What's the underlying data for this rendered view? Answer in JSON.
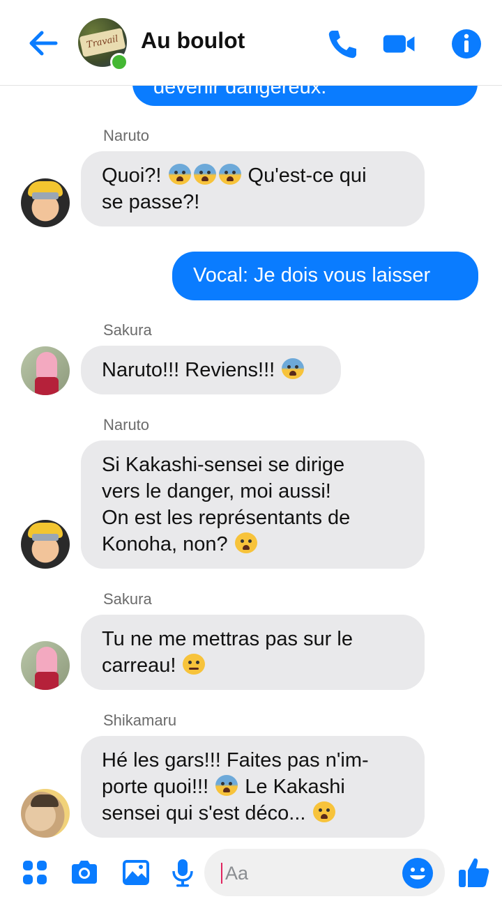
{
  "header": {
    "title": "Au boulot",
    "avatar_text": "Travail",
    "back_icon": "back-arrow-icon",
    "actions": [
      "phone-icon",
      "video-camera-icon",
      "info-icon"
    ]
  },
  "messages": {
    "top_partial": "devenir dangereux.",
    "m1": {
      "sender": "Naruto",
      "line1": "Quoi?! ",
      "line1b": " Qu'est-ce qui",
      "line2": "se passe?!"
    },
    "m2": {
      "text": "Vocal: Je dois vous laisser"
    },
    "m3": {
      "sender": "Sakura",
      "text": "Naruto!!! Reviens!!! "
    },
    "m4": {
      "sender": "Naruto",
      "line1": "Si Kakashi-sensei se dirige",
      "line2": "vers le danger, moi aussi!",
      "line3": "On est les représentants de",
      "line4": "Konoha, non? "
    },
    "m5": {
      "sender": "Sakura",
      "line1": "Tu ne me mettras pas sur le",
      "line2": "carreau! "
    },
    "m6": {
      "sender": "Shikamaru",
      "line1": "Hé les gars!!! Faites pas n'im-",
      "line2": "porte quoi!!! ",
      "line2b": " Le Kakashi",
      "line3": "sensei qui s'est déco... "
    }
  },
  "composer": {
    "placeholder": "Aa",
    "icons": [
      "apps-grid-icon",
      "camera-icon",
      "image-icon",
      "microphone-icon",
      "emoji-icon",
      "thumbs-up-icon"
    ]
  },
  "colors": {
    "accent": "#0a7cff",
    "incoming_bubble": "#e9e9eb",
    "online": "#44b733"
  }
}
